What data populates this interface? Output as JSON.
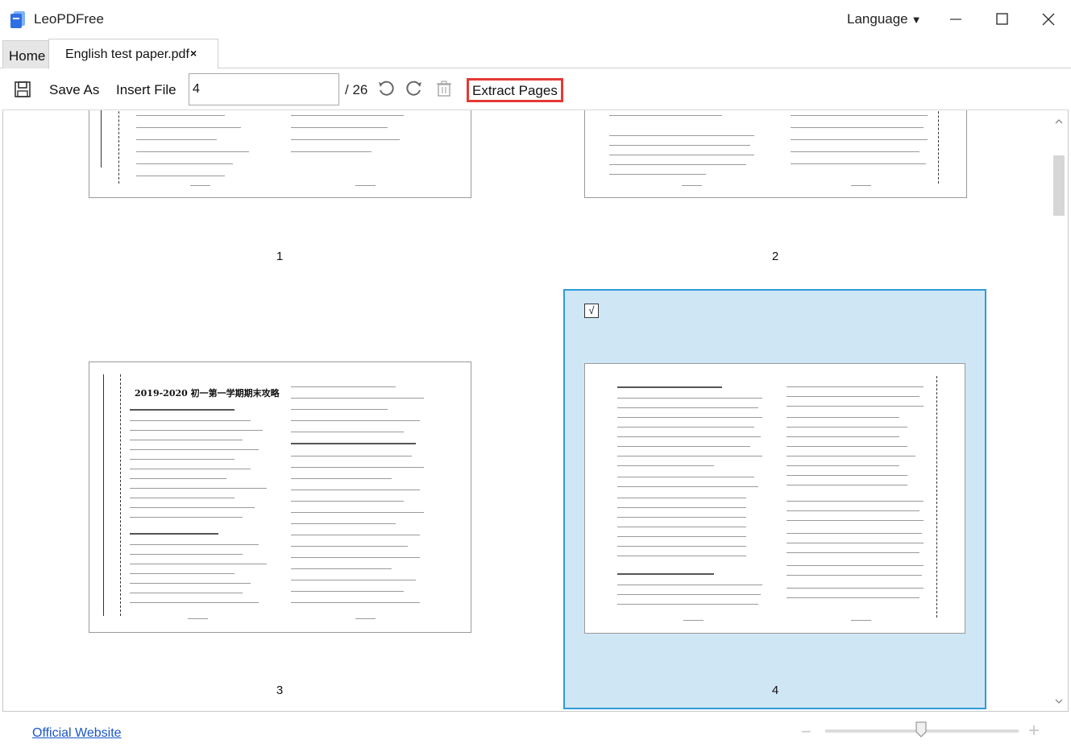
{
  "app": {
    "title": "LeoPDFree",
    "language_label": "Language"
  },
  "tabs": [
    {
      "label": "Home"
    },
    {
      "label": "English test paper.pdf",
      "close": "×"
    }
  ],
  "toolbar": {
    "save_as": "Save As",
    "insert_file": "Insert File",
    "page_value": "4",
    "page_total": "/ 26",
    "extract": "Extract Pages"
  },
  "pages": [
    {
      "number": "1",
      "selected": false
    },
    {
      "number": "2",
      "selected": false
    },
    {
      "number": "3",
      "selected": false,
      "heading": "2019-2020 初一第一学期期末攻略"
    },
    {
      "number": "4",
      "selected": true,
      "check": "√"
    }
  ],
  "footer": {
    "official_website": "Official Website"
  },
  "colors": {
    "selection_bg": "#cfe6f5",
    "selection_border": "#2f9bd6",
    "highlight_red": "#e53935",
    "link": "#1a56c9"
  }
}
